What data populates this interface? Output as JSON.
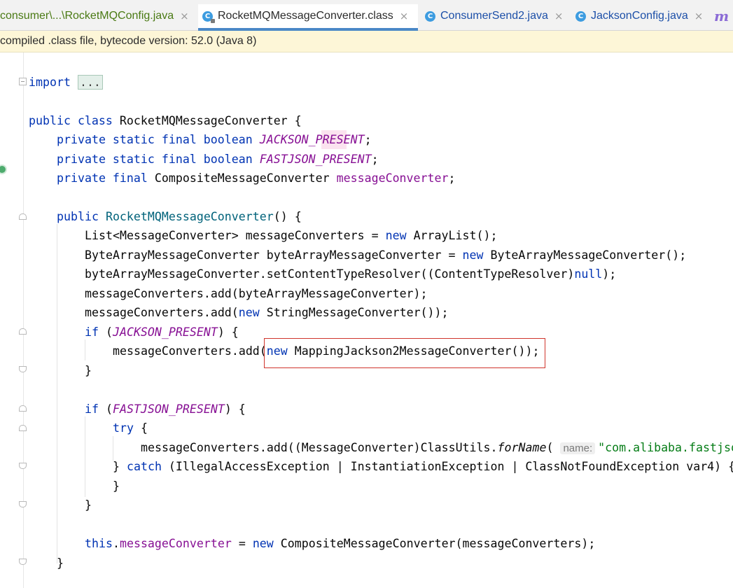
{
  "tabs": [
    {
      "label": "consumer\\...\\RocketMQConfig.java",
      "icon": "java-file-icon",
      "close": "×"
    },
    {
      "label": "RocketMQMessageConverter.class",
      "icon": "class-file-icon",
      "close": "×"
    },
    {
      "label": "ConsumerSend2.java",
      "icon": "class-icon",
      "close": "×"
    },
    {
      "label": "JacksonConfig.java",
      "icon": "class-icon",
      "close": "×"
    },
    {
      "label": "m",
      "icon": "more-tabs-icon"
    }
  ],
  "class_icon_letter": "C",
  "banner": {
    "text": "compiled .class file, bytecode version: 52.0 (Java 8)"
  },
  "code": {
    "import_kw": "import",
    "import_dots": "...",
    "class_decl": {
      "public": "public",
      "class": "class",
      "name": "RocketMQMessageConverter {"
    },
    "field1": {
      "mods": "private static final boolean",
      "name": "JACKSON_PRESENT",
      "end": ";"
    },
    "field2": {
      "mods": "private static final boolean",
      "name": "FASTJSON_PRESENT",
      "end": ";"
    },
    "field3": {
      "mods": "private final",
      "type": "CompositeMessageConverter",
      "name": "messageConverter",
      "end": ";"
    },
    "ctor": {
      "public": "public",
      "name": "RocketMQMessageConverter",
      "rest": "() {"
    },
    "l1": {
      "a": "List<MessageConverter> messageConverters = ",
      "new": "new",
      "b": " ArrayList();"
    },
    "l2": {
      "a": "ByteArrayMessageConverter byteArrayMessageConverter = ",
      "new": "new",
      "b": " ByteArrayMessageConverter();"
    },
    "l3": {
      "a": "byteArrayMessageConverter.setContentTypeResolver((ContentTypeResolver)",
      "null": "null",
      "b": ");"
    },
    "l4": {
      "a": "messageConverters.add(byteArrayMessageConverter);"
    },
    "l5": {
      "a": "messageConverters.add(",
      "new": "new",
      "b": " StringMessageConverter());"
    },
    "if1": {
      "if": "if",
      "open": " (",
      "cond": "JACKSON_PRESENT",
      "close": ") {"
    },
    "l6": {
      "a": "messageConverters.add(",
      "new": "new",
      "b": " MappingJackson2MessageConverter());"
    },
    "brace": "}",
    "if2": {
      "if": "if",
      "open": " (",
      "cond": "FASTJSON_PRESENT",
      "close": ") {"
    },
    "try": {
      "kw": "try",
      "rest": " {"
    },
    "l7": {
      "a": "messageConverters.add((MessageConverter)ClassUtils.",
      "m": "forName",
      "p": "(",
      "hint": "name:",
      "str": "\"com.alibaba.fastjson"
    },
    "catch": {
      "a": "} ",
      "kw": "catch",
      "b": " (IllegalAccessException | InstantiationException | ClassNotFoundException var4) {"
    },
    "l8": {
      "this": "this",
      "dot": ".",
      "fld": "messageConverter",
      "eq": " = ",
      "new": "new",
      "b": " CompositeMessageConverter(messageConverters);"
    }
  },
  "colors": {
    "keyword": "#0033b3",
    "field": "#871094",
    "string": "#067d17",
    "highlight_box": "#d0352c",
    "banner_bg": "#fdf6d7"
  }
}
